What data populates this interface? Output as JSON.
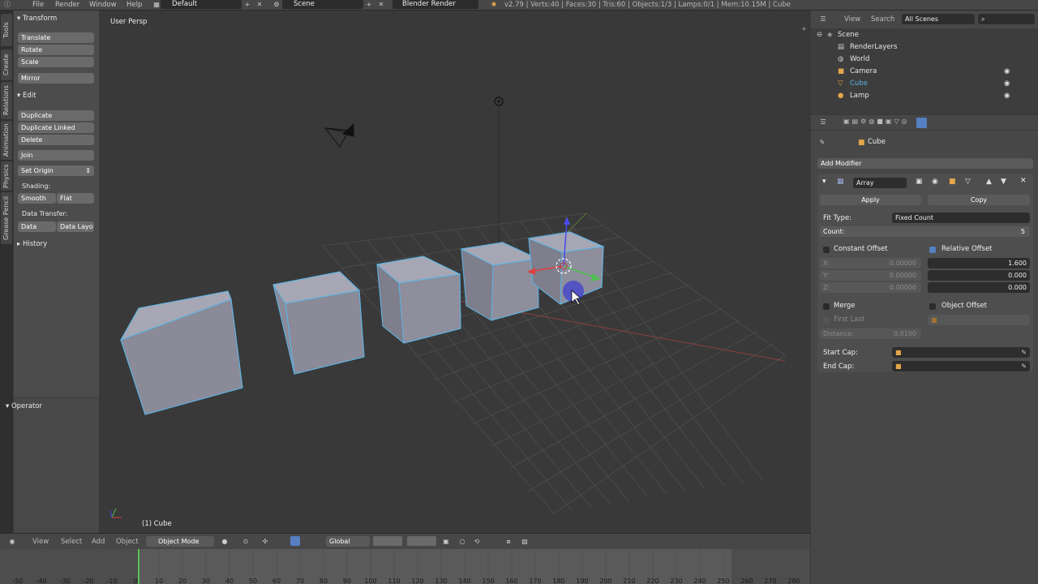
{
  "top_bar": {
    "menus": [
      "File",
      "Render",
      "Window",
      "Help"
    ],
    "screen_layout": "Default",
    "scene": "Scene",
    "render_engine": "Blender Render",
    "stats": "v2.79 | Verts:40 | Faces:30 | Tris:60 | Objects:1/3 | Lamps:0/1 | Mem:10.15M | Cube"
  },
  "side_tabs": [
    "Tools",
    "Create",
    "Relations",
    "Animation",
    "Physics",
    "Grease Pencil"
  ],
  "tool_shelf": {
    "transform_header": "Transform",
    "translate": "Translate",
    "rotate": "Rotate",
    "scale": "Scale",
    "mirror": "Mirror",
    "edit_header": "Edit",
    "duplicate": "Duplicate",
    "duplicate_linked": "Duplicate Linked",
    "delete": "Delete",
    "join": "Join",
    "set_origin": "Set Origin",
    "shading_label": "Shading:",
    "smooth": "Smooth",
    "flat": "Flat",
    "data_transfer_label": "Data Transfer:",
    "data": "Data",
    "data_layout": "Data Layo",
    "history_header": "History",
    "operator_header": "Operator"
  },
  "viewport": {
    "view_label": "User Persp",
    "object_label": "(1) Cube"
  },
  "view3d_header": {
    "menus": [
      "View",
      "Select",
      "Add",
      "Object"
    ],
    "mode": "Object Mode",
    "orientation": "Global"
  },
  "timeline": {
    "ticks": [
      "-50",
      "-40",
      "-30",
      "-20",
      "-10",
      "0",
      "10",
      "20",
      "30",
      "40",
      "50",
      "60",
      "70",
      "80",
      "90",
      "100",
      "110",
      "120",
      "130",
      "140",
      "150",
      "160",
      "170",
      "180",
      "190",
      "200",
      "210",
      "220",
      "230",
      "240",
      "250",
      "260",
      "270",
      "280"
    ]
  },
  "outliner": {
    "view": "View",
    "search": "Search",
    "filter": "All Scenes",
    "items": [
      {
        "label": "Scene",
        "selected": false
      },
      {
        "label": "RenderLayers",
        "selected": false
      },
      {
        "label": "World",
        "selected": false
      },
      {
        "label": "Camera",
        "selected": false
      },
      {
        "label": "Cube",
        "selected": true
      },
      {
        "label": "Lamp",
        "selected": false
      }
    ]
  },
  "properties": {
    "object_name": "Cube",
    "add_modifier": "Add Modifier",
    "modifier_name": "Array",
    "apply": "Apply",
    "copy": "Copy",
    "fit_type_label": "Fit Type:",
    "fit_type_value": "Fixed Count",
    "count_label": "Count:",
    "count_value": "5",
    "constant_offset": "Constant Offset",
    "relative_offset": "Relative Offset",
    "constant": {
      "x_label": "X:",
      "x": "0.00000",
      "y_label": "Y:",
      "y": "0.00000",
      "z_label": "Z:",
      "z": "0.00000"
    },
    "relative": {
      "x": "1.600",
      "y": "0.000",
      "z": "0.000"
    },
    "merge": "Merge",
    "object_offset": "Object Offset",
    "first_last": "First Last",
    "distance_label": "Distance:",
    "distance_value": "0.0100",
    "start_cap": "Start Cap:",
    "end_cap": "End Cap:"
  },
  "colors": {
    "selection": "#5bb6e8",
    "accent_blue": "#5680c2",
    "grid": "#4d4d4d"
  }
}
